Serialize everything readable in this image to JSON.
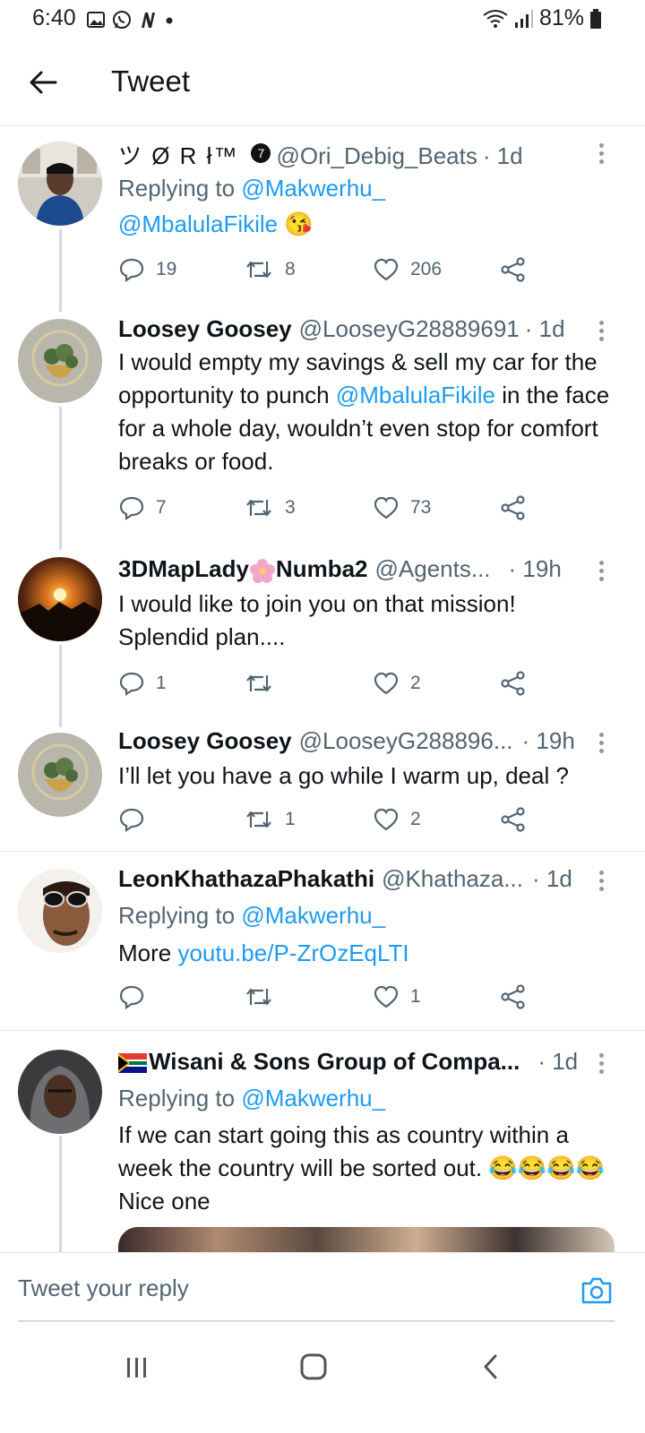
{
  "status_bar": {
    "time": "6:40",
    "battery": "81%"
  },
  "header": {
    "title": "Tweet"
  },
  "tweets": [
    {
      "name": "ツ Ø R ł™",
      "badge": "7",
      "handle": "@Ori_Debig_Beats",
      "time": "· 1d",
      "replying_prefix": "Replying to",
      "replying_to": "@Makwerhu_",
      "mention": "@MbalulaFikile",
      "emoji": "😘",
      "replies": "19",
      "retweets": "8",
      "likes": "206"
    },
    {
      "name": "Loosey Goosey",
      "handle": "@LooseyG28889691",
      "time": "· 1d",
      "text_before": "I would empty my savings & sell my car for the opportunity to punch ",
      "mention": "@MbalulaFikile",
      "text_after": " in the face for a whole day, wouldn’t even stop for comfort breaks or food.",
      "replies": "7",
      "retweets": "3",
      "likes": "73"
    },
    {
      "name_a": "3DMapLady",
      "name_b": "Numba2",
      "handle": "@Agents...",
      "time": "· 19h",
      "text": "I would like to join you on that mission! Splendid plan....",
      "replies": "1",
      "retweets": "",
      "likes": "2"
    },
    {
      "name": "Loosey Goosey",
      "handle": "@LooseyG288896...",
      "time": "· 19h",
      "text": "I’ll let you have a go while I warm up, deal ?",
      "replies": "",
      "retweets": "1",
      "likes": "2"
    },
    {
      "name": "LeonKhathazaPhakathi",
      "handle": "@Khathaza...",
      "time": "· 1d",
      "replying_prefix": "Replying to",
      "replying_to": "@Makwerhu_",
      "text": "More ",
      "link": "youtu.be/P-ZrOzEqLTI",
      "replies": "",
      "retweets": "",
      "likes": "1"
    },
    {
      "name": "Wisani & Sons Group of Compa...",
      "time": "· 1d",
      "replying_prefix": "Replying to",
      "replying_to": "@Makwerhu_",
      "text": "If we can start going this as country within a week the country will be sorted out. 😂😂😂😂Nice one"
    }
  ],
  "reply_box": {
    "placeholder": "Tweet your reply"
  },
  "colors": {
    "link": "#1d9bf0",
    "muted": "#536471",
    "divider": "#e6e6e6",
    "thread_line": "#cfd9de"
  }
}
